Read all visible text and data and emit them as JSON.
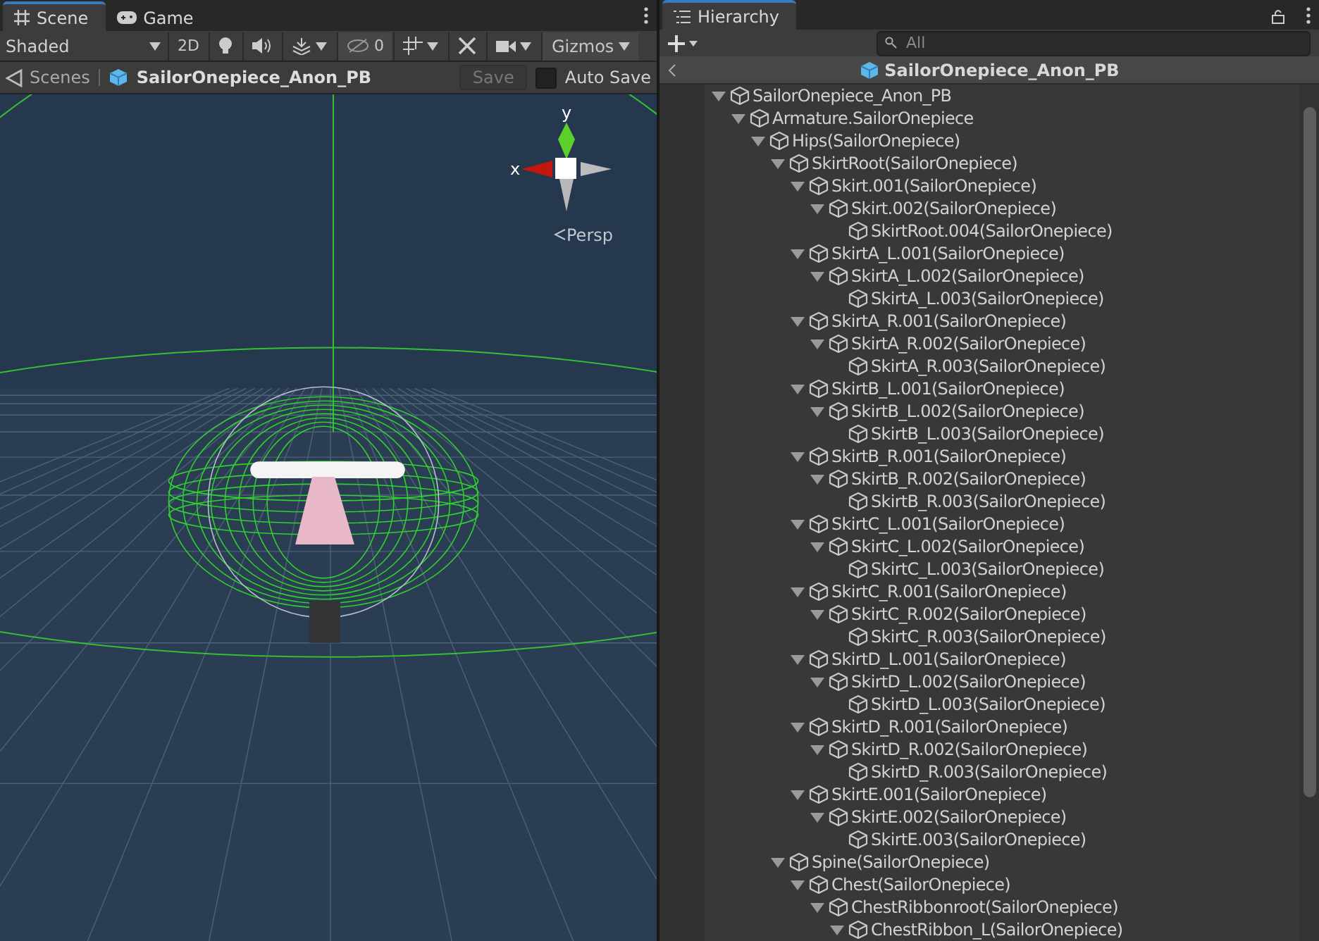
{
  "scene_panel": {
    "tabs": [
      {
        "label": "Scene",
        "kind": "scene",
        "selected": true
      },
      {
        "label": "Game",
        "kind": "game",
        "selected": false
      }
    ],
    "toolbar": {
      "shading": "Shaded",
      "mode_2d": "2D",
      "hidden_count": "0",
      "gizmos": "Gizmos"
    },
    "breadcrumb": {
      "root": "Scenes",
      "prefab": "SailorOnepiece_Anon_PB",
      "save": {
        "label": "Save",
        "disabled": true
      },
      "auto_save": {
        "label": "Auto Save",
        "checked": false
      }
    },
    "viewport": {
      "axis_y": "y",
      "axis_x": "x",
      "projection": "Persp"
    }
  },
  "hierarchy": {
    "tab": "Hierarchy",
    "search_placeholder": "All",
    "prefab_title": "SailorOnepiece_Anon_PB",
    "tree": [
      {
        "label": "SailorOnepiece_Anon_PB",
        "expanded": true,
        "children": [
          {
            "label": "Armature.SailorOnepiece",
            "expanded": true,
            "children": [
              {
                "label": "Hips(SailorOnepiece)",
                "expanded": true,
                "children": [
                  {
                    "label": "SkirtRoot(SailorOnepiece)",
                    "expanded": true,
                    "children": [
                      {
                        "label": "Skirt.001(SailorOnepiece)",
                        "expanded": true,
                        "children": [
                          {
                            "label": "Skirt.002(SailorOnepiece)",
                            "expanded": true,
                            "children": [
                              {
                                "label": "SkirtRoot.004(SailorOnepiece)"
                              }
                            ]
                          }
                        ]
                      },
                      {
                        "label": "SkirtA_L.001(SailorOnepiece)",
                        "expanded": true,
                        "children": [
                          {
                            "label": "SkirtA_L.002(SailorOnepiece)",
                            "expanded": true,
                            "children": [
                              {
                                "label": "SkirtA_L.003(SailorOnepiece)"
                              }
                            ]
                          }
                        ]
                      },
                      {
                        "label": "SkirtA_R.001(SailorOnepiece)",
                        "expanded": true,
                        "children": [
                          {
                            "label": "SkirtA_R.002(SailorOnepiece)",
                            "expanded": true,
                            "children": [
                              {
                                "label": "SkirtA_R.003(SailorOnepiece)"
                              }
                            ]
                          }
                        ]
                      },
                      {
                        "label": "SkirtB_L.001(SailorOnepiece)",
                        "expanded": true,
                        "children": [
                          {
                            "label": "SkirtB_L.002(SailorOnepiece)",
                            "expanded": true,
                            "children": [
                              {
                                "label": "SkirtB_L.003(SailorOnepiece)"
                              }
                            ]
                          }
                        ]
                      },
                      {
                        "label": "SkirtB_R.001(SailorOnepiece)",
                        "expanded": true,
                        "children": [
                          {
                            "label": "SkirtB_R.002(SailorOnepiece)",
                            "expanded": true,
                            "children": [
                              {
                                "label": "SkirtB_R.003(SailorOnepiece)"
                              }
                            ]
                          }
                        ]
                      },
                      {
                        "label": "SkirtC_L.001(SailorOnepiece)",
                        "expanded": true,
                        "children": [
                          {
                            "label": "SkirtC_L.002(SailorOnepiece)",
                            "expanded": true,
                            "children": [
                              {
                                "label": "SkirtC_L.003(SailorOnepiece)"
                              }
                            ]
                          }
                        ]
                      },
                      {
                        "label": "SkirtC_R.001(SailorOnepiece)",
                        "expanded": true,
                        "children": [
                          {
                            "label": "SkirtC_R.002(SailorOnepiece)",
                            "expanded": true,
                            "children": [
                              {
                                "label": "SkirtC_R.003(SailorOnepiece)"
                              }
                            ]
                          }
                        ]
                      },
                      {
                        "label": "SkirtD_L.001(SailorOnepiece)",
                        "expanded": true,
                        "children": [
                          {
                            "label": "SkirtD_L.002(SailorOnepiece)",
                            "expanded": true,
                            "children": [
                              {
                                "label": "SkirtD_L.003(SailorOnepiece)"
                              }
                            ]
                          }
                        ]
                      },
                      {
                        "label": "SkirtD_R.001(SailorOnepiece)",
                        "expanded": true,
                        "children": [
                          {
                            "label": "SkirtD_R.002(SailorOnepiece)",
                            "expanded": true,
                            "children": [
                              {
                                "label": "SkirtD_R.003(SailorOnepiece)"
                              }
                            ]
                          }
                        ]
                      },
                      {
                        "label": "SkirtE.001(SailorOnepiece)",
                        "expanded": true,
                        "children": [
                          {
                            "label": "SkirtE.002(SailorOnepiece)",
                            "expanded": true,
                            "children": [
                              {
                                "label": "SkirtE.003(SailorOnepiece)"
                              }
                            ]
                          }
                        ]
                      }
                    ]
                  },
                  {
                    "label": "Spine(SailorOnepiece)",
                    "expanded": true,
                    "children": [
                      {
                        "label": "Chest(SailorOnepiece)",
                        "expanded": true,
                        "children": [
                          {
                            "label": "ChestRibbonroot(SailorOnepiece)",
                            "expanded": true,
                            "children": [
                              {
                                "label": "ChestRibbon_L(SailorOnepiece)",
                                "expanded": true
                              }
                            ]
                          }
                        ]
                      }
                    ]
                  }
                ]
              }
            ]
          }
        ]
      }
    ]
  }
}
